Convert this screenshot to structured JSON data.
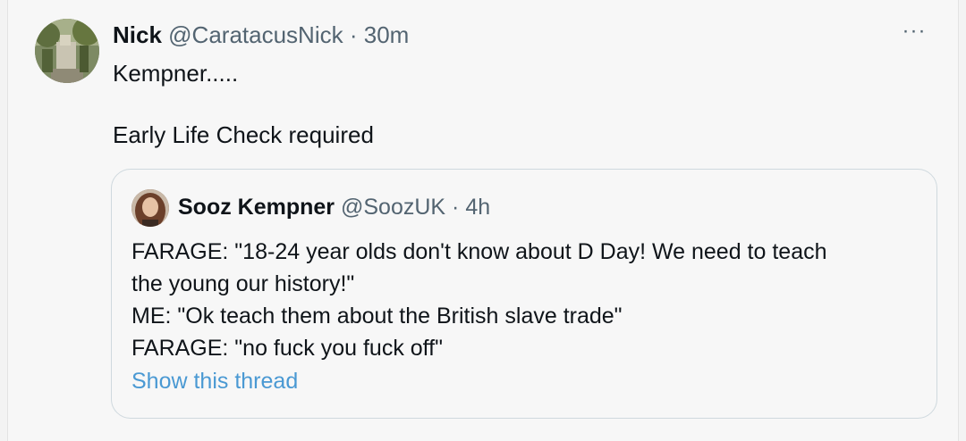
{
  "tweet": {
    "author_name": "Nick",
    "author_handle": "@CaratacusNick",
    "separator": "·",
    "time": "30m",
    "more_label": "···",
    "text_line1": "Kempner.....",
    "text_line2": "Early Life Check required",
    "avatar_icon": "user-avatar-garden-statue"
  },
  "quoted": {
    "author_name": "Sooz Kempner",
    "author_handle": "@SoozUK",
    "separator": "·",
    "time": "4h",
    "lines": [
      "FARAGE: \"18-24 year olds don't know about D Day! We need to teach",
      "the young our history!\"",
      "ME: \"Ok teach them about the British slave trade\"",
      "FARAGE: \"no fuck you fuck off\""
    ],
    "show_thread_label": "Show this thread",
    "link_color": "#4a99d3"
  }
}
